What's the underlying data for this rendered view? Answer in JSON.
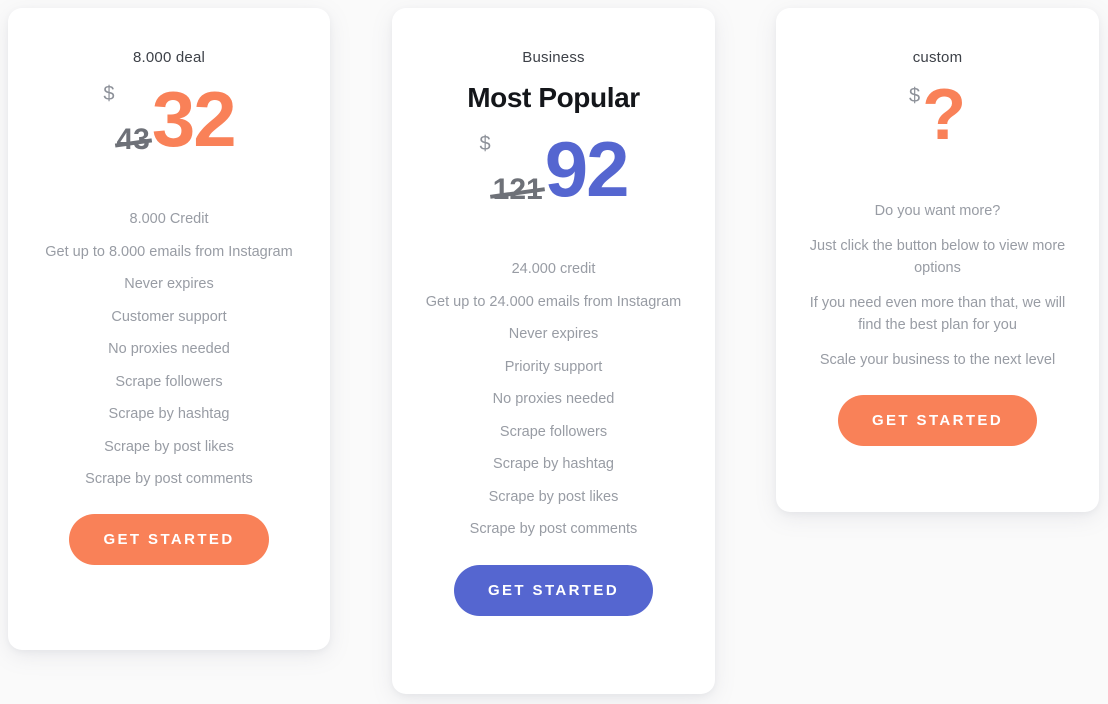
{
  "plans": [
    {
      "id": "starter",
      "name": "8.000 deal",
      "tagline": "",
      "currency": "$",
      "price_old": "43",
      "price_new": "32",
      "accent": "#f98158",
      "features": [
        "8.000 Credit",
        "Get up to 8.000 emails from Instagram",
        "Never expires",
        "Customer support",
        "No proxies needed",
        "Scrape followers",
        "Scrape by hashtag",
        "Scrape by post likes",
        "Scrape by post comments"
      ],
      "cta_label": "GET STARTED"
    },
    {
      "id": "business",
      "name": "Business",
      "tagline": "Most Popular",
      "currency": "$",
      "price_old": "121",
      "price_new": "92",
      "accent": "#5566d0",
      "features": [
        "24.000 credit",
        "Get up to 24.000 emails from Instagram",
        "Never expires",
        "Priority support",
        "No proxies needed",
        "Scrape followers",
        "Scrape by hashtag",
        "Scrape by post likes",
        "Scrape by post comments"
      ],
      "cta_label": "GET STARTED"
    },
    {
      "id": "custom",
      "name": "custom",
      "tagline": "",
      "currency": "$",
      "price_unknown": "?",
      "accent": "#f98158",
      "features": [
        "Do you want more?",
        "Just click the button below to view more options",
        "If you need even more than that, we will find the best plan for you",
        "Scale your business to the next level"
      ],
      "cta_label": "GET STARTED"
    }
  ]
}
